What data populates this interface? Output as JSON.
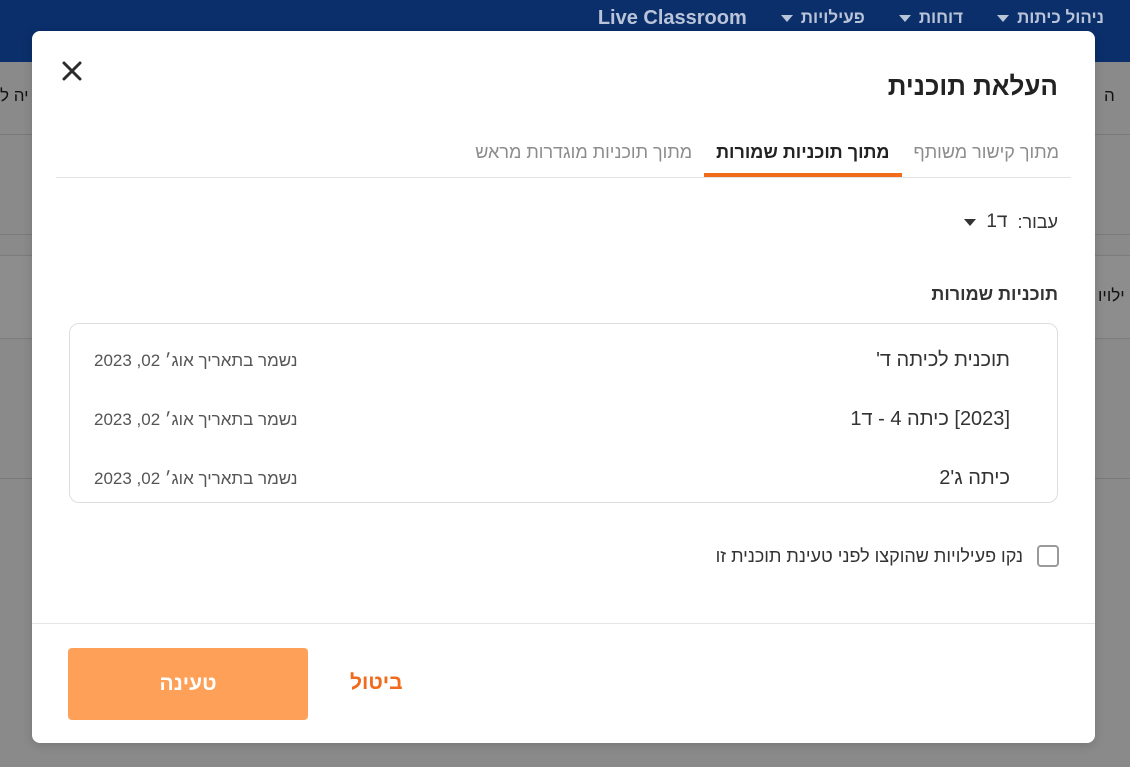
{
  "app": {
    "brand": "Live Classroom",
    "nav": [
      {
        "label": "פעילויות"
      },
      {
        "label": "דוחות"
      },
      {
        "label": "ניהול כיתות"
      }
    ],
    "bg_left_fragment_1": "יה ל",
    "bg_right_fragment_1": "ה",
    "bg_left_fragment_2": "ילויו"
  },
  "modal": {
    "title": "העלאת תוכנית",
    "tabs": [
      {
        "label": "מתוך קישור משותף",
        "active": false
      },
      {
        "label": "מתוך תוכניות שמורות",
        "active": true
      },
      {
        "label": "מתוך תוכניות מוגדרות מראש",
        "active": false
      }
    ],
    "for_label": "עבור:",
    "for_value": "ד1",
    "section_title": "תוכניות שמורות",
    "plans": [
      {
        "name": "תוכנית לכיתה ד'",
        "saved": "נשמר בתאריך אוג׳ 02, 2023"
      },
      {
        "name": "[2023] כיתה 4 - ד1",
        "saved": "נשמר בתאריך אוג׳ 02, 2023"
      },
      {
        "name": "כיתה ג'2",
        "saved": "נשמר בתאריך אוג׳ 02, 2023"
      }
    ],
    "clear_checkbox_label": "נקו פעילויות שהוקצו לפני טעינת תוכנית זו",
    "clear_checkbox_checked": false,
    "load_button": "טעינה",
    "cancel_button": "ביטול"
  },
  "colors": {
    "topbar": "#0b2f6b",
    "accent": "#f26a1b",
    "load_button_bg": "#ffa058",
    "overlay": "#8a8a8a"
  }
}
